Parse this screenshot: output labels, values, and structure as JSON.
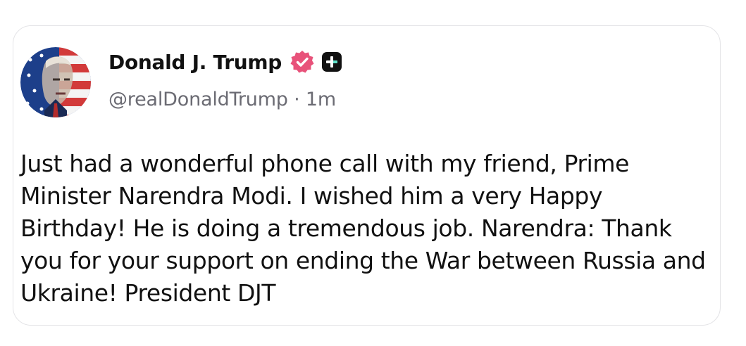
{
  "post": {
    "author": {
      "display_name": "Donald J. Trump",
      "handle": "@realDonaldTrump",
      "separator": " · ",
      "time_ago": "1m",
      "verified_icon": "verified-badge-icon",
      "truth_plus_icon": "truth-plus-icon",
      "avatar_icon": "avatar"
    },
    "text": "Just had a wonderful phone call with my friend, Prime Minister Narendra Modi. I wished him a very Happy Birthday! He is doing a tremendous job. Narendra: Thank you for your support on ending the War between Russia and Ukraine! President DJT"
  },
  "colors": {
    "verified": "#e8527a",
    "card_border": "#e4e4e7",
    "muted_text": "#6b6b73",
    "text": "#111111",
    "badge_dark": "#111111",
    "badge_accent": "#5de0c8"
  }
}
